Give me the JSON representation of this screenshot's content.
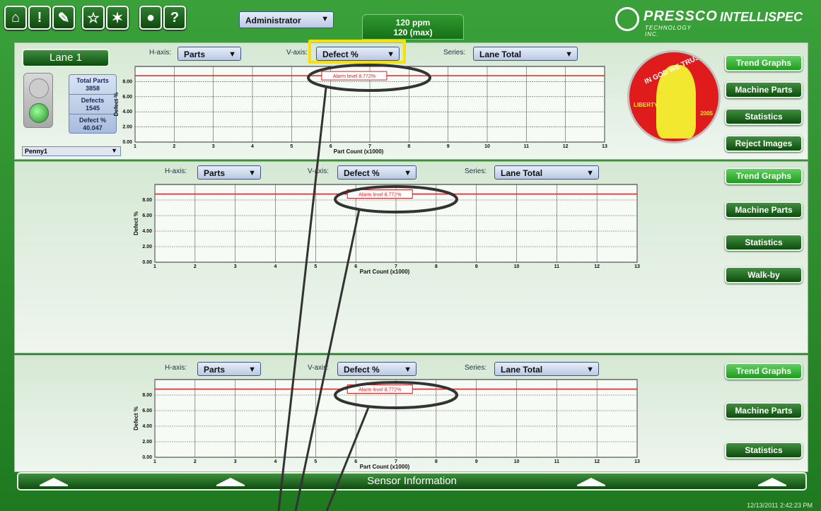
{
  "toolbar": {
    "icons": [
      "home-icon",
      "alert-icon",
      "wrench-icon",
      "star-icon",
      "wand-icon",
      "globe-icon",
      "help-icon"
    ],
    "alert": "!",
    "help": "?",
    "user": "Administrator",
    "ppm": "120 ppm",
    "ppm_max": "120 (max)"
  },
  "logos": {
    "pressco": "PRESSCO",
    "pressco_sub": "TECHNOLOGY INC.",
    "intellispec": "INTELLISPEC"
  },
  "lane": {
    "title": "Lane 1",
    "stats": {
      "total_label": "Total Parts",
      "total": "3858",
      "defects_label": "Defects",
      "defects": "1545",
      "pct_label": "Defect %",
      "pct": "40.047"
    },
    "product": "Penny1"
  },
  "controls": {
    "haxis_label": "H-axis:",
    "haxis": "Parts",
    "vaxis_label": "V-axis:",
    "vaxis": "Defect %",
    "series_label": "Series:",
    "series": "Lane Total"
  },
  "coin": {
    "motto": "IN GOD WE TRUST",
    "liberty": "LIBERTY",
    "year": "2005"
  },
  "nav": {
    "trend": "Trend Graphs",
    "machine": "Machine Parts",
    "statistics": "Statistics",
    "reject": "Reject Images",
    "walkby": "Walk-by"
  },
  "footer": {
    "label": "Sensor Information",
    "timestamp": "12/13/2011 2:42:23 PM"
  },
  "chart_data": [
    {
      "type": "line",
      "xlabel": "Part Count (x1000)",
      "ylabel": "Defect %",
      "x_ticks": [
        1,
        2,
        3,
        4,
        5,
        6,
        7,
        8,
        9,
        10,
        11,
        12,
        13
      ],
      "y_ticks": [
        0,
        2,
        4,
        6,
        8
      ],
      "y_tick_labels": [
        "0.00",
        "2.00",
        "4.00",
        "6.00",
        "8.00"
      ],
      "xlim": [
        1,
        13
      ],
      "ylim": [
        0,
        10
      ],
      "alarm": {
        "value": 8.772,
        "label": "Alarm level 8.772%"
      },
      "grid": true
    },
    {
      "type": "line",
      "xlabel": "Part Count (x1000)",
      "ylabel": "Defect %",
      "x_ticks": [
        1,
        2,
        3,
        4,
        5,
        6,
        7,
        8,
        9,
        10,
        11,
        12,
        13
      ],
      "y_ticks": [
        0,
        2,
        4,
        6,
        8
      ],
      "y_tick_labels": [
        "0.00",
        "2.00",
        "4.00",
        "6.00",
        "8.00"
      ],
      "xlim": [
        1,
        13
      ],
      "ylim": [
        0,
        10
      ],
      "alarm": {
        "value": 8.772,
        "label": "Alarm level 8.772%"
      },
      "grid": true
    },
    {
      "type": "line",
      "xlabel": "Part Count (x1000)",
      "ylabel": "Defect %",
      "x_ticks": [
        1,
        2,
        3,
        4,
        5,
        6,
        7,
        8,
        9,
        10,
        11,
        12,
        13
      ],
      "y_ticks": [
        0,
        2,
        4,
        6,
        8
      ],
      "y_tick_labels": [
        "0.00",
        "2.00",
        "4.00",
        "6.00",
        "8.00"
      ],
      "xlim": [
        1,
        13
      ],
      "ylim": [
        0,
        10
      ],
      "alarm": {
        "value": 8.772,
        "label": "Alarm level 8.772%"
      },
      "grid": true
    }
  ]
}
